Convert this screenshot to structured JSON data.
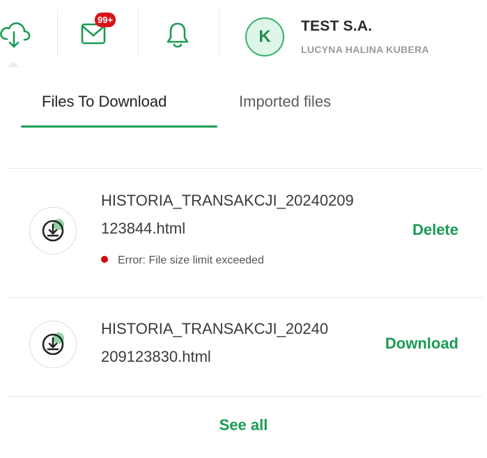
{
  "header": {
    "download_icon": "cloud-download-icon",
    "mail_icon": "envelope-icon",
    "mail_badge": "99+",
    "notification_icon": "bell-icon",
    "avatar_initial": "K",
    "company_name": "TEST S.A.",
    "user_name": "LUCYNA HALINA KUBERA"
  },
  "tabs": [
    {
      "label": "Files To Download",
      "active": true
    },
    {
      "label": "Imported files",
      "active": false
    }
  ],
  "files": [
    {
      "name": "HISTORIA_TRANSAKCJI_20240209123844.html",
      "name_line1": "HISTORIA_TRANSAKCJI_20240209",
      "name_line2": "123844.html",
      "error": "Error: File size limit exceeded",
      "action": "Delete",
      "icon": "download-circle-icon"
    },
    {
      "name": "HISTORIA_TRANSAKCJI_20240209123830.html",
      "name_line1": "HISTORIA_TRANSAKCJI_20240",
      "name_line2": "209123830.html",
      "error": "",
      "action": "Download",
      "icon": "download-circle-icon"
    }
  ],
  "footer": {
    "see_all_label": "See all"
  },
  "colors": {
    "accent": "#1a9b53",
    "error": "#d10a10",
    "badge": "#d6141c"
  }
}
